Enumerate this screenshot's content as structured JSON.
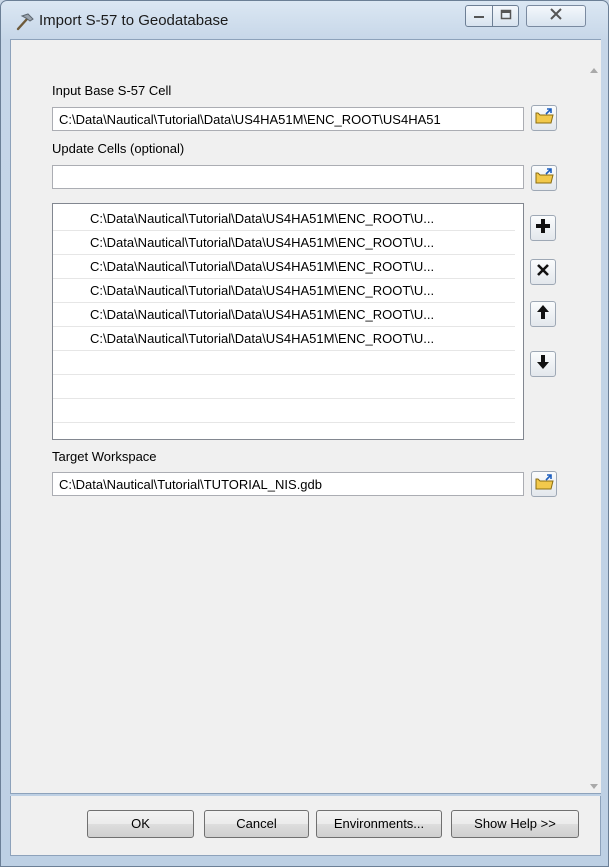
{
  "window": {
    "title": "Import S-57 to Geodatabase"
  },
  "titlebar": {
    "icons": [
      "tool-hammer-icon",
      "minimize-icon",
      "maximize-icon",
      "close-icon"
    ]
  },
  "form": {
    "input_base": {
      "label": "Input Base S-57 Cell",
      "value": "C:\\Data\\Nautical\\Tutorial\\Data\\US4HA51M\\ENC_ROOT\\US4HA51"
    },
    "update_cells": {
      "label": "Update Cells (optional)",
      "value": "",
      "items": [
        "C:\\Data\\Nautical\\Tutorial\\Data\\US4HA51M\\ENC_ROOT\\U...",
        "C:\\Data\\Nautical\\Tutorial\\Data\\US4HA51M\\ENC_ROOT\\U...",
        "C:\\Data\\Nautical\\Tutorial\\Data\\US4HA51M\\ENC_ROOT\\U...",
        "C:\\Data\\Nautical\\Tutorial\\Data\\US4HA51M\\ENC_ROOT\\U...",
        "C:\\Data\\Nautical\\Tutorial\\Data\\US4HA51M\\ENC_ROOT\\U...",
        "C:\\Data\\Nautical\\Tutorial\\Data\\US4HA51M\\ENC_ROOT\\U..."
      ],
      "empty_rows": 3,
      "list_buttons": [
        "add-icon",
        "remove-icon",
        "move-up-icon",
        "move-down-icon"
      ]
    },
    "target_workspace": {
      "label": "Target Workspace",
      "value": "C:\\Data\\Nautical\\Tutorial\\TUTORIAL_NIS.gdb"
    },
    "browse_icon": "folder-open-icon"
  },
  "buttons": {
    "ok": "OK",
    "cancel": "Cancel",
    "environments": "Environments...",
    "show_help": "Show Help >>"
  },
  "colors": {
    "window_frame": "#c6d6e8",
    "dialog_bg": "#f0f0f0",
    "folder_icon": "#f2c94c",
    "close_glyph": "#555555"
  }
}
